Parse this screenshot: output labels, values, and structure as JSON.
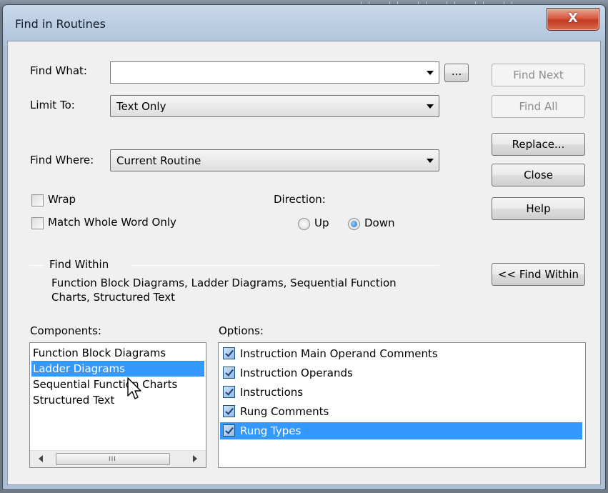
{
  "window": {
    "title": "Find in Routines",
    "close_glyph": "X"
  },
  "find_what": {
    "label": "Find What:",
    "value": "",
    "browse_label": "..."
  },
  "limit_to": {
    "label": "Limit To:",
    "value": "Text Only"
  },
  "find_where": {
    "label": "Find Where:",
    "value": "Current Routine"
  },
  "options_checks": {
    "wrap_label": "Wrap",
    "wrap_checked": false,
    "match_whole_label": "Match Whole Word Only",
    "match_whole_checked": false
  },
  "direction": {
    "label": "Direction:",
    "up_label": "Up",
    "down_label": "Down",
    "selected": "Down"
  },
  "buttons": {
    "find_next": "Find Next",
    "find_all": "Find All",
    "replace": "Replace...",
    "close": "Close",
    "help": "Help",
    "find_within": "<< Find Within"
  },
  "find_within": {
    "heading": "Find Within",
    "summary_line1": "Function Block Diagrams, Ladder Diagrams, Sequential Function",
    "summary_line2": "Charts, Structured Text"
  },
  "components": {
    "label": "Components:",
    "items": [
      {
        "label": "Function Block Diagrams",
        "selected": false
      },
      {
        "label": "Ladder Diagrams",
        "selected": true
      },
      {
        "label": "Sequential Function Charts",
        "selected": false
      },
      {
        "label": "Structured Text",
        "selected": false
      }
    ],
    "scroll_grip": "III"
  },
  "options": {
    "label": "Options:",
    "items": [
      {
        "label": "Instruction Main Operand Comments",
        "checked": true,
        "selected": false
      },
      {
        "label": "Instruction Operands",
        "checked": true,
        "selected": false
      },
      {
        "label": "Instructions",
        "checked": true,
        "selected": false
      },
      {
        "label": "Rung Comments",
        "checked": true,
        "selected": false
      },
      {
        "label": "Rung Types",
        "checked": true,
        "selected": true
      }
    ]
  },
  "colors": {
    "selection": "#3399ff",
    "dialog_bg": "#f0f0f0",
    "close_red": "#c43a22"
  }
}
